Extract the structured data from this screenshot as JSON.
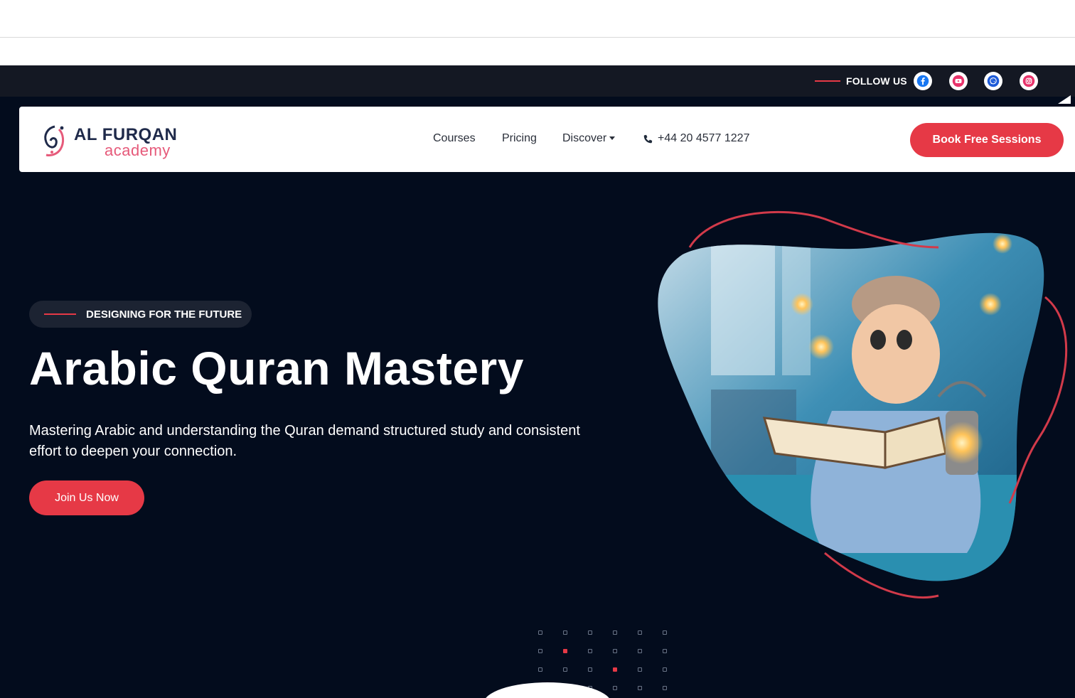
{
  "social_bar": {
    "follow_label": "FOLLOW US",
    "icons": [
      "facebook-icon",
      "youtube-icon",
      "whatsapp-icon",
      "instagram-icon"
    ]
  },
  "navbar": {
    "logo": {
      "line1": "AL FURQAN",
      "line2": "academy",
      "arabic": "فرقان"
    },
    "links": [
      {
        "label": "Courses"
      },
      {
        "label": "Pricing"
      },
      {
        "label": "Discover"
      }
    ],
    "phone": "+44 20 4577 1227",
    "cta": "Book Free Sessions"
  },
  "hero": {
    "tag": "DESIGNING FOR THE FUTURE",
    "title": "Arabic Quran Mastery",
    "description": "Mastering Arabic and understanding the Quran demand structured study and consistent effort to deepen your connection.",
    "cta": "Join Us Now",
    "image_alt": "child-reading-quran-with-lantern-image"
  },
  "colors": {
    "accent": "#e63946",
    "background": "#030c1d",
    "topbar": "#141823",
    "brand_navy": "#1f2a4a",
    "brand_pink": "#e65a7a"
  }
}
